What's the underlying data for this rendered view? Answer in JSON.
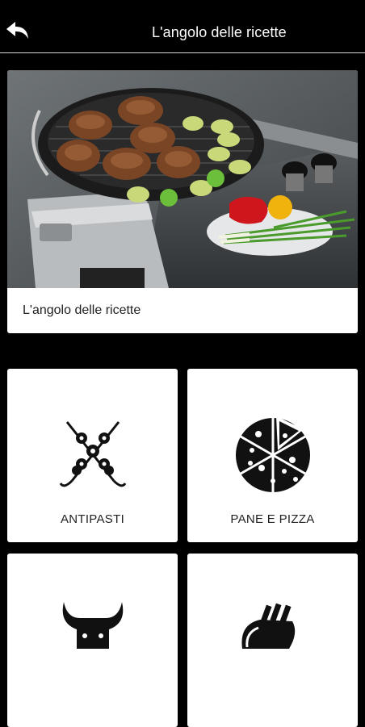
{
  "header": {
    "title": "L'angolo delle ricette",
    "back_icon": "back-arrow-icon"
  },
  "hero": {
    "caption": "L'angolo delle ricette"
  },
  "categories": [
    {
      "label": "ANTIPASTI",
      "icon": "skewers-icon"
    },
    {
      "label": "PANE E PIZZA",
      "icon": "pizza-icon"
    },
    {
      "label": "",
      "icon": "bull-head-icon"
    },
    {
      "label": "",
      "icon": "rack-of-lamb-icon"
    }
  ]
}
